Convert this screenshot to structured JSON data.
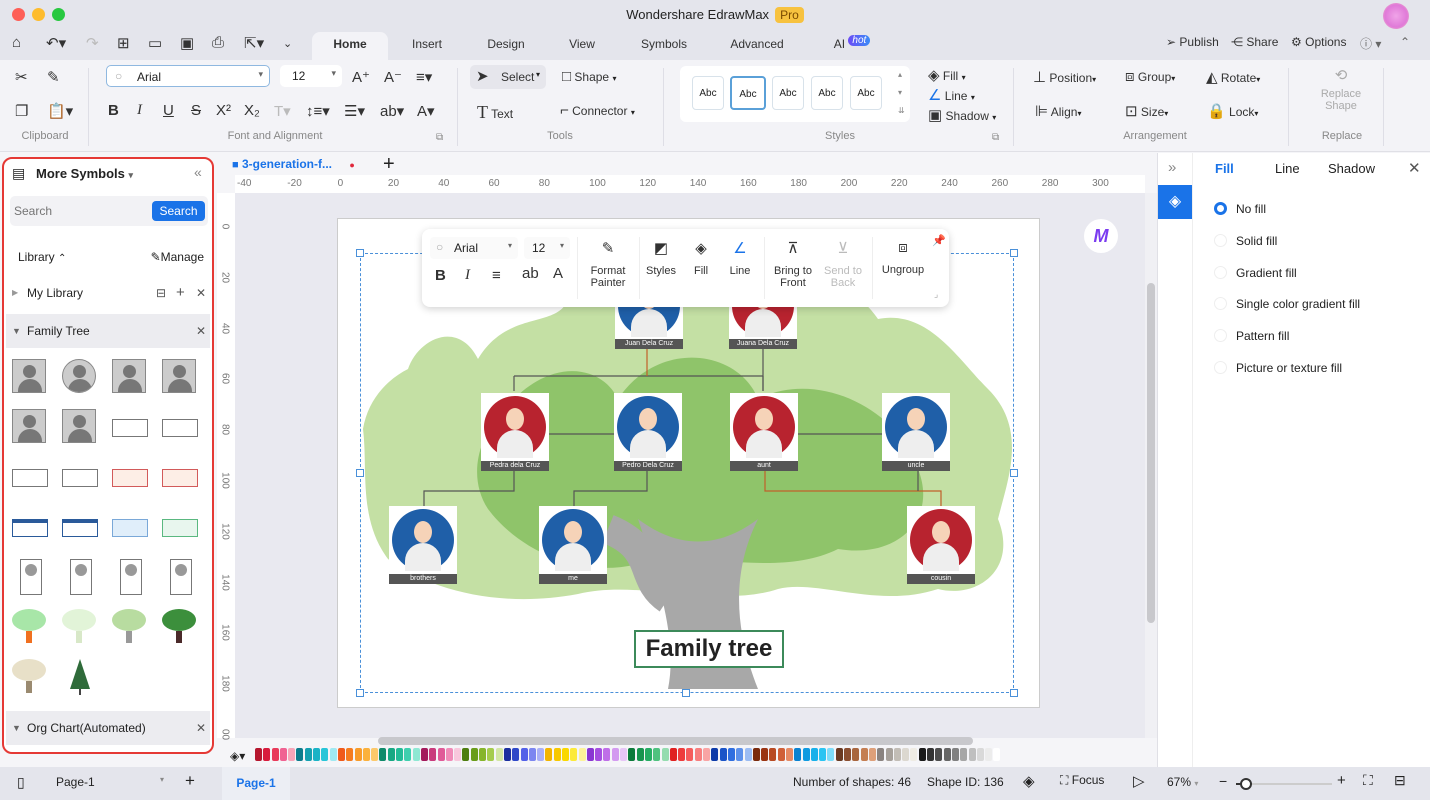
{
  "window": {
    "title": "Wondershare EdrawMax",
    "badge": "Pro"
  },
  "menu_tabs": [
    {
      "label": "Home",
      "active": true
    },
    {
      "label": "Insert"
    },
    {
      "label": "Design"
    },
    {
      "label": "View"
    },
    {
      "label": "Symbols"
    },
    {
      "label": "Advanced"
    },
    {
      "label": "AI",
      "badge": "hot"
    }
  ],
  "top_right": {
    "publish": "Publish",
    "share": "Share",
    "options": "Options"
  },
  "ribbon": {
    "clipboard_label": "Clipboard",
    "font_label": "Font and Alignment",
    "font_name": "Arial",
    "font_size": "12",
    "tools_label": "Tools",
    "select": "Select",
    "shape": "Shape",
    "text": "Text",
    "connector": "Connector",
    "styles_label": "Styles",
    "style_samples": [
      "Abc",
      "Abc",
      "Abc",
      "Abc",
      "Abc"
    ],
    "fill": "Fill",
    "line": "Line",
    "shadow": "Shadow",
    "arrangement_label": "Arrangement",
    "position": "Position",
    "group": "Group",
    "rotate": "Rotate",
    "align": "Align",
    "size": "Size",
    "lock": "Lock",
    "replace_shape": "Replace Shape",
    "replace_label": "Replace"
  },
  "left_panel": {
    "title": "More Symbols",
    "search_placeholder": "Search",
    "search_button": "Search",
    "library": "Library",
    "manage": "Manage",
    "my_library": "My Library",
    "family_tree": "Family Tree",
    "org_chart": "Org Chart(Automated)"
  },
  "document": {
    "tab_name": "3-generation-f..."
  },
  "ruler": {
    "h_ticks": [
      "-40",
      "-20",
      "0",
      "20",
      "40",
      "60",
      "80",
      "100",
      "120",
      "140",
      "160",
      "180",
      "200",
      "220",
      "240",
      "260",
      "280",
      "300"
    ],
    "v_ticks": [
      "0",
      "20",
      "40",
      "60",
      "80",
      "100",
      "120",
      "140",
      "160",
      "180",
      "00"
    ]
  },
  "floating_toolbar": {
    "font": "Arial",
    "size": "12",
    "format_painter": "Format Painter",
    "styles": "Styles",
    "fill": "Fill",
    "line": "Line",
    "bring_to_front": "Bring to Front",
    "send_to_back": "Send to Back",
    "ungroup": "Ungroup"
  },
  "diagram": {
    "title": "Family tree",
    "people": [
      {
        "name": "Juan Dela Cruz",
        "color": "#1f5fa8"
      },
      {
        "name": "Juana Dela Cruz",
        "color": "#b8232f"
      },
      {
        "name": "Pedra dela Cruz",
        "color": "#b8232f"
      },
      {
        "name": "Pedro Dela Cruz",
        "color": "#1f5fa8"
      },
      {
        "name": "aunt",
        "color": "#b8232f"
      },
      {
        "name": "uncle",
        "color": "#1f5fa8"
      },
      {
        "name": "brothers",
        "color": "#1f5fa8"
      },
      {
        "name": "me",
        "color": "#1f5fa8"
      },
      {
        "name": "cousin",
        "color": "#b8232f"
      }
    ]
  },
  "right_panel": {
    "tabs": [
      "Fill",
      "Line",
      "Shadow"
    ],
    "active_tab": "Fill",
    "options": [
      "No fill",
      "Solid fill",
      "Gradient fill",
      "Single color gradient fill",
      "Pattern fill",
      "Picture or texture fill"
    ],
    "selected": "No fill"
  },
  "status": {
    "page_select": "Page-1",
    "page_tab": "Page-1",
    "shapes": "Number of shapes: 46",
    "shape_id": "Shape ID: 136",
    "focus": "Focus",
    "zoom": "67%",
    "zoom_fraction": 0.1
  },
  "palette": [
    "#b5162e",
    "#d81b3c",
    "#e83a5a",
    "#f06292",
    "#f8a5b8",
    "#0d7c8c",
    "#14a0b0",
    "#1ab3c6",
    "#27c5d8",
    "#a0e9f2",
    "#f05a1a",
    "#f57c1f",
    "#f89b2a",
    "#fbb13c",
    "#fcc96b",
    "#0f8a6a",
    "#17a883",
    "#22bb96",
    "#3fcfae",
    "#8ee8d3",
    "#a3195b",
    "#c93a7c",
    "#e05a98",
    "#f08bb8",
    "#f8c7dc",
    "#4e7d0f",
    "#6a9c1a",
    "#86b52b",
    "#a5cc4d",
    "#d3e7a4",
    "#1b2f9e",
    "#2f48c8",
    "#5260e8",
    "#7c86f0",
    "#aab0f6",
    "#f2b400",
    "#f7c800",
    "#fad800",
    "#fcea3a",
    "#fdf39a",
    "#8a36d2",
    "#a54ee0",
    "#bf6ee8",
    "#d39af0",
    "#e7c6f7",
    "#0b7a3a",
    "#17954e",
    "#25ad63",
    "#4fc27f",
    "#94dcaf",
    "#e02020",
    "#ee3c3c",
    "#f55c5c",
    "#f77e7e",
    "#f9a4a4",
    "#0c3aa8",
    "#1a54c8",
    "#2f6ee0",
    "#5c90ea",
    "#9bbcf3",
    "#7a2a0c",
    "#9a3412",
    "#b84a22",
    "#d06038",
    "#e68a64",
    "#0a82d0",
    "#0f9ae0",
    "#17b0ea",
    "#2ac4f2",
    "#7fdcf8",
    "#6a3a22",
    "#8a4e30",
    "#a8663e",
    "#c47e52",
    "#dea07a",
    "#8a8380",
    "#a6a09a",
    "#c2bdb6",
    "#dcd8d0",
    "#efece4",
    "#1a1a1a",
    "#333333",
    "#4d4d4d",
    "#666666",
    "#808080",
    "#a6a6a6",
    "#bfbfbf",
    "#d9d9d9",
    "#ececec",
    "#ffffff"
  ]
}
